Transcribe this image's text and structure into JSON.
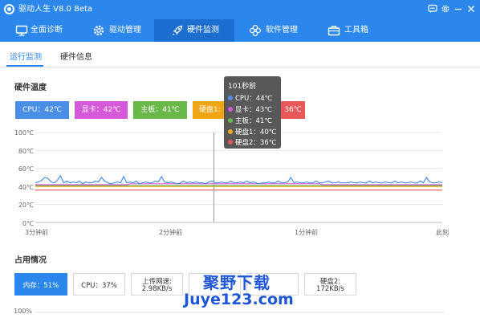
{
  "window": {
    "title": "驱动人生 V8.0 Beta",
    "controls": [
      "message-icon",
      "gear-icon",
      "minimize-icon",
      "close-icon"
    ]
  },
  "nav": {
    "items": [
      {
        "label": "全面诊断",
        "icon": "monitor-icon"
      },
      {
        "label": "驱动管理",
        "icon": "gear-icon"
      },
      {
        "label": "硬件监测",
        "icon": "rocket-icon",
        "active": true
      },
      {
        "label": "软件管理",
        "icon": "flower-icon"
      },
      {
        "label": "工具箱",
        "icon": "toolbox-icon"
      }
    ]
  },
  "subtabs": [
    {
      "label": "运行监测",
      "active": true
    },
    {
      "label": "硬件信息"
    }
  ],
  "temperature": {
    "section_title": "硬件温度",
    "chips": [
      {
        "label": "CPU：42℃",
        "color": "#4b8ee8"
      },
      {
        "label": "显卡：42℃",
        "color": "#d55ad9"
      },
      {
        "label": "主板：41℃",
        "color": "#6bb84a"
      },
      {
        "label": "硬盘1:",
        "color": "#f0a612"
      },
      {
        "label": "36℃",
        "color": "#e8575a"
      }
    ],
    "tooltip": {
      "time": "101秒前",
      "rows": [
        {
          "label": "CPU：44℃",
          "color": "#4b8ee8"
        },
        {
          "label": "显卡：43℃",
          "color": "#d55ad9"
        },
        {
          "label": "主板：41℃",
          "color": "#6bb84a"
        },
        {
          "label": "硬盘1：40℃",
          "color": "#f0a612"
        },
        {
          "label": "硬盘2：36℃",
          "color": "#e8575a"
        }
      ]
    }
  },
  "chart_data": {
    "type": "line",
    "ylim": [
      0,
      100
    ],
    "y_ticks": [
      "100℃",
      "80℃",
      "60℃",
      "40℃",
      "20℃",
      "0℃"
    ],
    "x_ticks": [
      "3分钟前",
      "2分钟前",
      "1分钟前",
      "此刻"
    ],
    "xlim_seconds_ago": [
      180,
      0
    ],
    "series": [
      {
        "name": "CPU",
        "color": "#4b8ee8",
        "values": [
          44,
          45,
          47,
          50,
          49,
          45,
          44,
          47,
          52,
          44,
          46,
          44,
          45,
          44,
          46,
          43,
          45,
          44,
          44,
          46,
          45,
          50,
          46,
          44,
          43,
          44,
          45,
          44,
          51,
          44,
          45,
          44,
          46,
          43,
          44,
          45,
          44,
          44,
          46,
          45,
          51,
          45,
          44,
          45,
          44,
          43,
          44,
          46,
          44,
          45,
          44,
          45,
          44,
          44,
          43,
          45,
          46,
          44,
          44,
          45,
          44,
          44,
          46,
          44,
          44,
          45,
          44,
          46,
          44,
          45,
          44,
          43,
          44,
          44,
          45,
          44,
          44,
          46,
          44,
          44,
          45,
          50,
          44,
          45,
          44,
          44,
          45,
          44,
          44,
          46,
          44,
          44,
          45,
          46,
          44,
          44,
          45,
          44,
          44,
          44,
          45,
          44,
          44,
          45,
          44,
          44,
          46,
          44,
          45,
          44,
          44,
          45,
          44,
          44,
          46,
          44,
          45,
          44,
          44,
          45,
          44,
          44,
          46,
          44,
          50,
          45,
          44,
          44,
          45,
          44
        ]
      },
      {
        "name": "显卡",
        "color": "#d55ad9",
        "values": [
          42,
          42,
          42,
          42,
          42,
          42,
          42,
          42,
          42,
          42,
          42,
          42,
          42,
          42,
          42,
          42,
          42,
          42,
          42,
          42,
          42,
          42,
          42,
          42,
          42,
          42,
          42,
          42,
          42,
          42,
          43,
          43,
          43,
          43,
          43,
          43,
          43,
          43,
          43,
          43,
          43,
          43,
          43,
          43,
          43,
          43,
          43,
          43,
          43,
          43,
          43,
          43,
          43,
          43,
          43,
          43,
          43,
          43,
          43,
          43,
          43,
          43,
          43,
          43,
          43,
          43,
          43,
          43,
          43,
          43,
          43,
          43,
          43,
          43,
          43,
          43,
          43,
          43,
          43,
          43,
          43,
          43,
          43,
          43,
          43,
          43,
          43,
          43,
          43,
          43,
          43,
          42,
          42,
          42,
          42,
          42,
          42,
          42,
          42,
          42,
          42,
          42,
          42,
          42,
          42,
          42,
          42,
          42,
          42,
          42,
          42,
          42,
          42,
          42,
          42,
          42,
          42,
          42,
          42,
          42,
          42,
          42,
          42,
          42,
          42,
          42,
          42,
          42,
          42,
          42
        ]
      },
      {
        "name": "主板",
        "color": "#6bb84a",
        "values": [
          41,
          41,
          41,
          41,
          41,
          41,
          41,
          41,
          41,
          41,
          41,
          41,
          41,
          41,
          41,
          41,
          41,
          41,
          41,
          41,
          41,
          41,
          41,
          41,
          41,
          41,
          41,
          41,
          41,
          41,
          41,
          41,
          41,
          41,
          41,
          41,
          41,
          41,
          41,
          41,
          41,
          41,
          41,
          41,
          41,
          41,
          41,
          41,
          41,
          41,
          41,
          41,
          41,
          41,
          41,
          41,
          41,
          41,
          41,
          41,
          41,
          41,
          41,
          41,
          41,
          41,
          41,
          41,
          41,
          41,
          41,
          41,
          41,
          41,
          41,
          41,
          41,
          41,
          41,
          41,
          41,
          41,
          41,
          41,
          41,
          41,
          41,
          41,
          41,
          41,
          41,
          41,
          41,
          41,
          41,
          41,
          41,
          41,
          41,
          41,
          41,
          41,
          41,
          41,
          41,
          41,
          41,
          41,
          41,
          41,
          41,
          41,
          41,
          41,
          41,
          41,
          41,
          41,
          41,
          41,
          41,
          41,
          41,
          41,
          41,
          41,
          41,
          41,
          41,
          41
        ]
      },
      {
        "name": "硬盘1",
        "color": "#f0a612",
        "values": [
          40,
          40,
          40,
          40,
          40,
          40,
          40,
          40,
          40,
          40,
          40,
          40,
          40,
          40,
          40,
          40,
          40,
          40,
          40,
          40,
          40,
          40,
          40,
          40,
          40,
          40,
          40,
          40,
          40,
          40,
          40,
          40,
          40,
          40,
          40,
          40,
          40,
          40,
          40,
          40,
          40,
          40,
          40,
          40,
          40,
          40,
          40,
          40,
          40,
          40,
          40,
          40,
          40,
          40,
          40,
          40,
          40,
          40,
          40,
          40,
          40,
          40,
          40,
          40,
          40,
          40,
          40,
          40,
          40,
          40,
          40,
          40,
          40,
          40,
          40,
          40,
          40,
          40,
          40,
          40,
          40,
          40,
          40,
          40,
          40,
          40,
          40,
          40,
          40,
          40,
          40,
          40,
          40,
          40,
          40,
          40,
          40,
          40,
          40,
          40,
          40,
          40,
          40,
          40,
          40,
          40,
          40,
          40,
          40,
          40,
          40,
          40,
          40,
          40,
          40,
          40,
          40,
          40,
          40,
          40,
          40,
          40,
          40,
          40,
          40,
          40,
          40,
          40,
          40,
          40
        ]
      },
      {
        "name": "硬盘2",
        "color": "#e8575a",
        "values": [
          36,
          36,
          36,
          36,
          36,
          36,
          36,
          36,
          36,
          36,
          36,
          36,
          36,
          36,
          36,
          36,
          36,
          36,
          36,
          36,
          36,
          36,
          36,
          36,
          36,
          36,
          36,
          36,
          36,
          36,
          36,
          36,
          36,
          36,
          36,
          36,
          36,
          36,
          36,
          36,
          36,
          36,
          36,
          36,
          36,
          36,
          36,
          36,
          36,
          36,
          36,
          36,
          36,
          36,
          36,
          36,
          36,
          36,
          36,
          36,
          36,
          36,
          36,
          36,
          36,
          36,
          36,
          36,
          36,
          36,
          36,
          36,
          36,
          36,
          36,
          36,
          36,
          36,
          36,
          36,
          36,
          36,
          36,
          36,
          36,
          36,
          36,
          36,
          36,
          36,
          36,
          36,
          36,
          36,
          36,
          36,
          36,
          36,
          36,
          36,
          36,
          36,
          36,
          36,
          36,
          36,
          36,
          36,
          36,
          36,
          36,
          36,
          36,
          36,
          36,
          36,
          36,
          36,
          36,
          36,
          36,
          36,
          36,
          36,
          36,
          36,
          36,
          36,
          36,
          36
        ]
      }
    ],
    "cursor_seconds_ago": 101,
    "grid": true
  },
  "usage": {
    "section_title": "占用情况",
    "boxes": [
      {
        "line1": "内存：51%",
        "active": true
      },
      {
        "line1": "CPU：37%"
      },
      {
        "line1": "上传网速:",
        "line2": "2.98KB/s"
      },
      {
        "line1": "",
        "line2": ""
      },
      {
        "line1": "",
        "line2": ""
      },
      {
        "line1": "硬盘2:",
        "line2": "172KB/s"
      }
    ],
    "y_tick_top": "100%"
  },
  "watermark": {
    "line1": "聚野下载",
    "line2": "Juye123.com"
  }
}
